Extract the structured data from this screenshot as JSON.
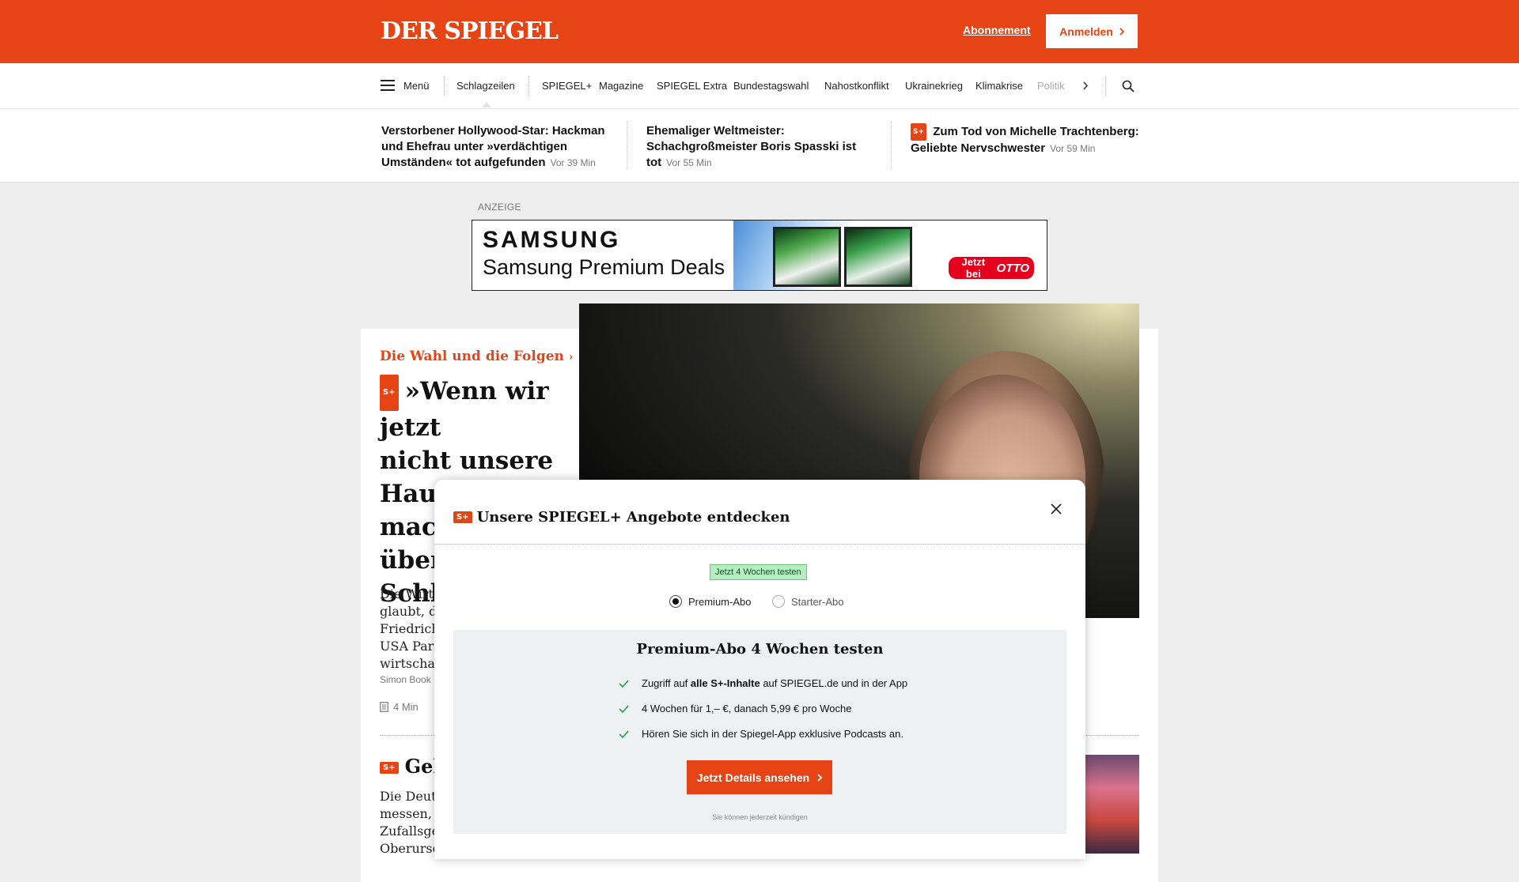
{
  "header": {
    "logo": "DER SPIEGEL",
    "subscription_link": "Abonnement",
    "login_button": "Anmelden"
  },
  "nav": {
    "menu_label": "Menü",
    "items": [
      "Schlagzeilen",
      "SPIEGEL+",
      "Magazine",
      "SPIEGEL Extra",
      "Bundestagswahl",
      "Nahostkonflikt",
      "Ukrainekrieg",
      "Klimakrise",
      "Politik"
    ]
  },
  "top_news": [
    {
      "title": "Verstorbener Hollywood-Star: Hackman und Ehefrau unter »verdächtigen Umständen« tot aufgefunden",
      "time": "Vor 39 Min",
      "plus": false
    },
    {
      "title": "Ehemaliger Weltmeister: Schachgroßmeister Boris Spasski ist tot",
      "time": "Vor 55 Min",
      "plus": false
    },
    {
      "title": "Zum Tod von Michelle Trachtenberg: Geliebte Nervschwester",
      "time": "Vor 59 Min",
      "plus": true
    }
  ],
  "ad": {
    "label": "ANZEIGE",
    "brand": "SAMSUNG",
    "headline": "Samsung Premium Deals",
    "cta_prefix": "Jetzt bei",
    "cta_brand": "OTTO"
  },
  "article": {
    "kicker": "Die Wahl und die Folgen",
    "headline_lines": [
      "»Wenn wir jetzt",
      "nicht unsere",
      "Hausaufgaben",
      "mach",
      "über",
      "Schli"
    ],
    "teaser_lines": [
      "Die Wirts",
      "glaubt, da",
      "Friedrich",
      "USA Paro",
      "wirtschaft"
    ],
    "author": "Simon Book",
    "read_time": "4 Min",
    "second_headline": "Geh",
    "second_teaser_lines": [
      "Die Deuts",
      "messen, si",
      "Zufallsger",
      "Oberursel"
    ]
  },
  "splus_badge": "S+",
  "modal": {
    "title": "Unsere SPIEGEL+ Angebote entdecken",
    "trial_badge": "Jetzt 4 Wochen testen",
    "options": [
      "Premium-Abo",
      "Starter-Abo"
    ],
    "selected_option": "Premium-Abo",
    "panel_title": "Premium-Abo 4 Wochen testen",
    "features": [
      {
        "pre": "Zugriff auf ",
        "bold": "alle S+-Inhalte",
        "post": " auf SPIEGEL.de und in der App"
      },
      {
        "pre": "4 Wochen für 1,– €, danach 5,99 € pro Woche",
        "bold": "",
        "post": ""
      },
      {
        "pre": "Hören Sie sich in der Spiegel-App exklusive Podcasts an.",
        "bold": "",
        "post": ""
      }
    ],
    "details_button": "Jetzt Details ansehen",
    "cancel_note": "Sie können jederzeit kündigen"
  },
  "colors": {
    "brand": "#e64415",
    "check": "#2e9e44",
    "otto_red": "#e5001e"
  }
}
